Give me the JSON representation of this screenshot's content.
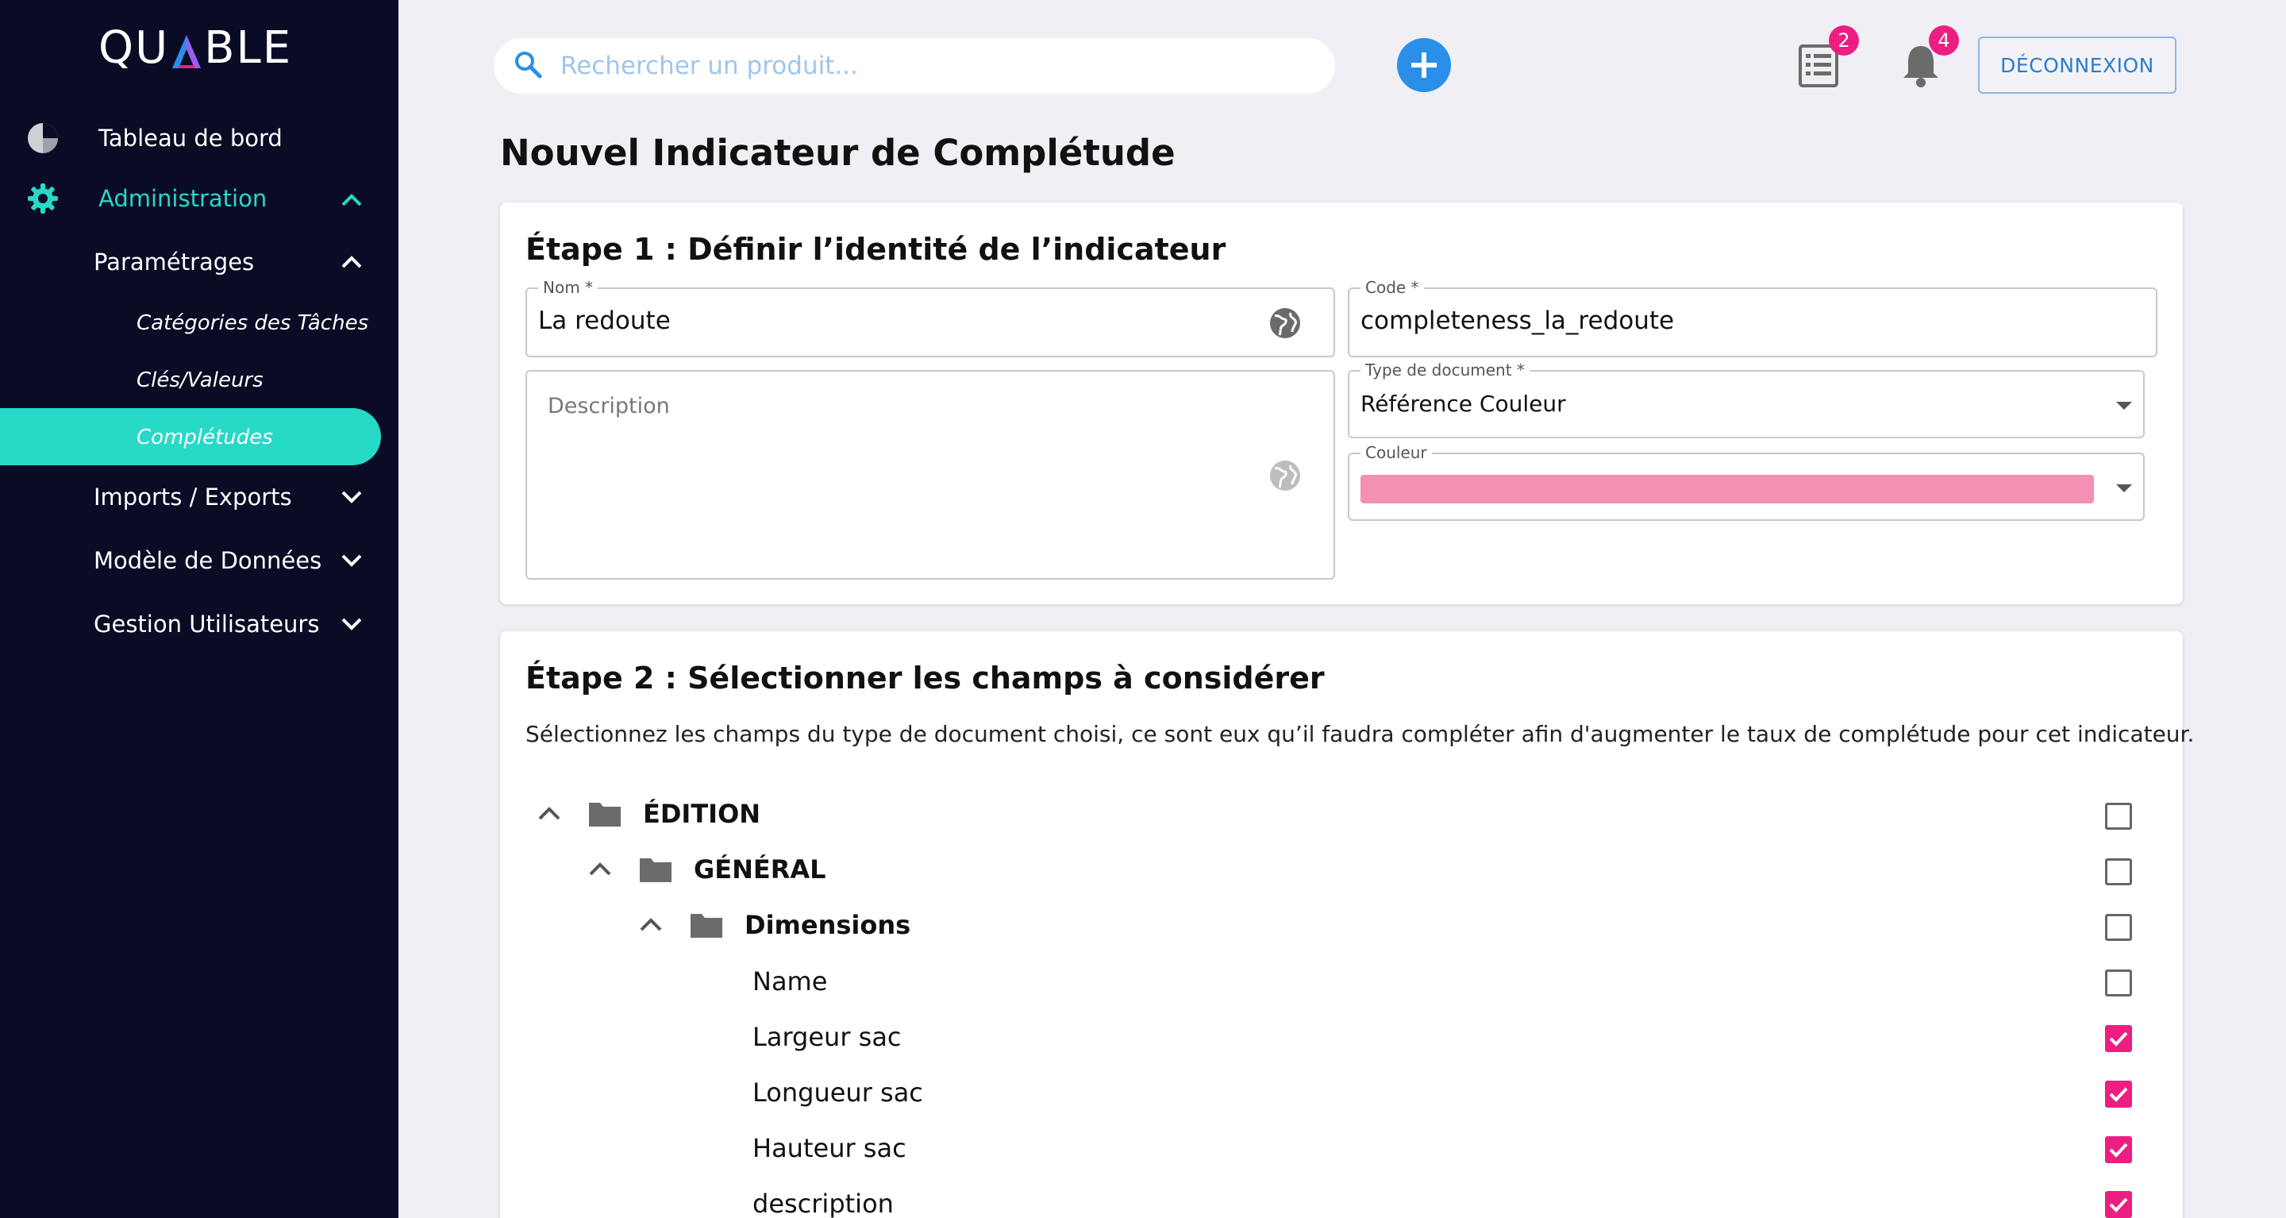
{
  "brand": {
    "name": "QUABLE"
  },
  "sidebar": {
    "dashboard": "Tableau de bord",
    "administration": "Administration",
    "settings": "Paramétrages",
    "sub_items": [
      "Catégories des Tâches",
      "Clés/Valeurs",
      "Complétudes"
    ],
    "imports": "Imports / Exports",
    "model": "Modèle de Données",
    "users": "Gestion Utilisateurs"
  },
  "topbar": {
    "search_placeholder": "Rechercher un produit...",
    "tasks_badge": "2",
    "notifications_badge": "4",
    "logout_label": "DÉCONNEXION"
  },
  "page": {
    "title": "Nouvel Indicateur de Complétude"
  },
  "step1": {
    "title": "Étape 1 : Définir l’identité de l’indicateur",
    "name_label": "Nom *",
    "name_value": "La redoute",
    "code_label": "Code *",
    "code_value": "completeness_la_redoute",
    "description_placeholder": "Description",
    "doctype_label": "Type de document *",
    "doctype_value": "Référence Couleur",
    "color_label": "Couleur",
    "color_value": "#f58fb3"
  },
  "step2": {
    "title": "Étape 2 : Sélectionner les champs à considérer",
    "description": "Sélectionnez les champs du type de document choisi, ce sont eux qu’il faudra compléter afin d'augmenter le taux de complétude pour cet indicateur.",
    "tree": [
      {
        "label": "ÉDITION",
        "checked": false
      },
      {
        "label": "GÉNÉRAL",
        "checked": false
      },
      {
        "label": "Dimensions",
        "checked": false
      },
      {
        "label": "Name",
        "checked": false
      },
      {
        "label": "Largeur sac",
        "checked": true
      },
      {
        "label": "Longueur sac",
        "checked": true
      },
      {
        "label": "Hauteur sac",
        "checked": true
      },
      {
        "label": "description",
        "checked": true
      }
    ]
  },
  "colors": {
    "sidebar_bg": "#0a0c26",
    "accent_teal": "#27d9c7",
    "primary_blue": "#2a8fe8",
    "badge_pink": "#ec1e82"
  }
}
